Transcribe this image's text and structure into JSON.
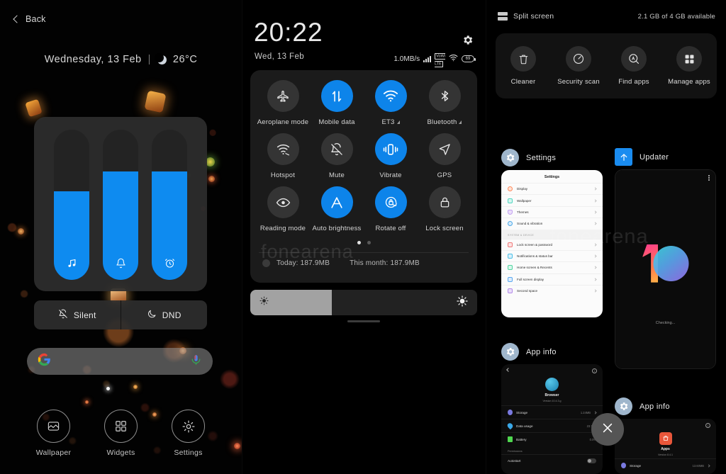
{
  "colors": {
    "accent_blue": "#0d84ea",
    "panel_dark": "#1b1b1b",
    "card_dark": "#121212",
    "tile_off": "#343434",
    "text_primary": "#e9e9e9",
    "text_secondary": "#c9c9c9",
    "updater_blue": "#1a8cf0"
  },
  "watermark": "fonearena",
  "left_panel": {
    "back_label": "Back",
    "back_icon": "chevron-left-icon",
    "date_line": {
      "date": "Wednesday, 13 Feb",
      "separator": "|",
      "weather_icon": "moon-icon",
      "temperature": "26°C"
    },
    "volume": {
      "sliders": [
        {
          "name": "media",
          "icon": "music-note-icon",
          "level_percent": 59
        },
        {
          "name": "ring",
          "icon": "bell-icon",
          "level_percent": 72
        },
        {
          "name": "alarm",
          "icon": "alarm-clock-icon",
          "level_percent": 72
        }
      ]
    },
    "modes": [
      {
        "label": "Silent",
        "icon": "bell-slash-icon"
      },
      {
        "label": "DND",
        "icon": "crescent-moon-icon"
      }
    ],
    "search": {
      "placeholder": "",
      "value": "",
      "left_icon": "google-g-icon",
      "right_icon": "microphone-icon"
    },
    "actions": [
      {
        "label": "Wallpaper",
        "icon": "wallpaper-icon"
      },
      {
        "label": "Widgets",
        "icon": "widgets-grid-icon"
      },
      {
        "label": "Settings",
        "icon": "gear-icon"
      }
    ]
  },
  "center_panel": {
    "clock": "20:22",
    "date": "Wed, 13 Feb",
    "settings_icon": "gear-icon",
    "status_bar": {
      "network_speed": "1.0MB/s",
      "signal_icon": "signal-bars-icon",
      "volte_label_top": "VoWi",
      "volte_label_bottom": "LTE",
      "wifi_icon": "wifi-icon",
      "battery_level": "69"
    },
    "tiles": [
      {
        "label": "Aeroplane mode",
        "icon": "airplane-icon",
        "active": false,
        "badge": ""
      },
      {
        "label": "Mobile data",
        "icon": "data-arrows-icon",
        "active": true,
        "badge": ""
      },
      {
        "label": "ET3",
        "icon": "wifi-icon",
        "active": true,
        "badge": "signal-corner"
      },
      {
        "label": "Bluetooth",
        "icon": "bluetooth-icon",
        "active": false,
        "badge": "signal-corner"
      },
      {
        "label": "Hotspot",
        "icon": "hotspot-icon",
        "active": false,
        "badge": ""
      },
      {
        "label": "Mute",
        "icon": "bell-slash-icon",
        "active": false,
        "badge": ""
      },
      {
        "label": "Vibrate",
        "icon": "vibrate-icon",
        "active": true,
        "badge": ""
      },
      {
        "label": "GPS",
        "icon": "location-arrow-icon",
        "active": false,
        "badge": ""
      },
      {
        "label": "Reading mode",
        "icon": "eye-icon",
        "active": false,
        "badge": ""
      },
      {
        "label": "Auto brightness",
        "icon": "letter-a-icon",
        "active": true,
        "badge": ""
      },
      {
        "label": "Rotate off",
        "icon": "rotate-lock-icon",
        "active": true,
        "badge": ""
      },
      {
        "label": "Lock screen",
        "icon": "padlock-icon",
        "active": false,
        "badge": ""
      }
    ],
    "page_dots": {
      "count": 2,
      "active_index": 0
    },
    "data_usage": {
      "today": "Today: 187.9MB",
      "this_month": "This month: 187.9MB"
    },
    "brightness": {
      "level_percent": 36,
      "low_icon": "brightness-low-icon",
      "high_icon": "brightness-high-icon"
    }
  },
  "right_panel": {
    "split_screen_label": "Split screen",
    "split_screen_icon": "split-screen-icon",
    "memory_status": "2.1 GB of 4 GB available",
    "tools": [
      {
        "label": "Cleaner",
        "icon": "trash-icon"
      },
      {
        "label": "Security scan",
        "icon": "shield-speed-icon"
      },
      {
        "label": "Find apps",
        "icon": "search-a-icon"
      },
      {
        "label": "Manage apps",
        "icon": "grid-apps-icon"
      }
    ],
    "recents": [
      {
        "app_name": "Settings",
        "app_icon": "gear-icon",
        "icon_bg": "#9fb6cc",
        "preview": {
          "type": "settings-list",
          "title": "Settings",
          "rows": [
            {
              "label": "Display",
              "color": "#ff8a5c"
            },
            {
              "label": "Wallpaper",
              "color": "#4fd6c0"
            },
            {
              "label": "Themes",
              "color": "#c3a3f0"
            },
            {
              "label": "Sound & vibration",
              "color": "#4aa8e8"
            }
          ],
          "section": "SYSTEM & DEVICE",
          "rows2": [
            {
              "label": "Lock screen & password",
              "color": "#f07a7a"
            },
            {
              "label": "Notifications & status bar",
              "color": "#4ac0e8"
            },
            {
              "label": "Home screen & Recents",
              "color": "#4fd6a0"
            },
            {
              "label": "Full screen display",
              "color": "#5aa8f0"
            },
            {
              "label": "Second space",
              "color": "#b48ae8"
            }
          ]
        }
      },
      {
        "app_name": "Updater",
        "app_icon": "up-arrow-icon",
        "icon_bg": "#1a8cf0",
        "preview": {
          "type": "updater",
          "logo": "MIUI 10",
          "status": "Checking..."
        }
      },
      {
        "app_name": "App info",
        "app_icon": "gear-icon",
        "icon_bg": "#9fb6cc",
        "preview": {
          "type": "app-info",
          "app_label": "Browser",
          "app_version": "Version 10.4.3.g",
          "app_icon_color": "#2fa6d6",
          "rows": [
            {
              "label": "Storage",
              "value": "1.24MB",
              "color": "#7a7ae0"
            },
            {
              "label": "Data usage",
              "value": "23.7KB",
              "color": "#3aa8e8"
            },
            {
              "label": "Battery",
              "value": "0.0%",
              "color": "#4fd64f"
            }
          ],
          "section": "Permissions",
          "toggle_row": {
            "label": "Autostart",
            "enabled": false
          }
        }
      },
      {
        "app_name": "App info",
        "app_icon": "gear-icon",
        "icon_bg": "#9fb6cc",
        "preview": {
          "type": "app-info",
          "app_label": "Apps",
          "app_version": "Version 8.4.1",
          "app_icon_color": "#e8563a",
          "rows": [
            {
              "label": "Storage",
              "value": "13.60MB",
              "color": "#7a7ae0"
            }
          ],
          "section": "",
          "toggle_row": null
        }
      }
    ],
    "close_button": {
      "icon": "close-x-icon",
      "label": ""
    }
  }
}
